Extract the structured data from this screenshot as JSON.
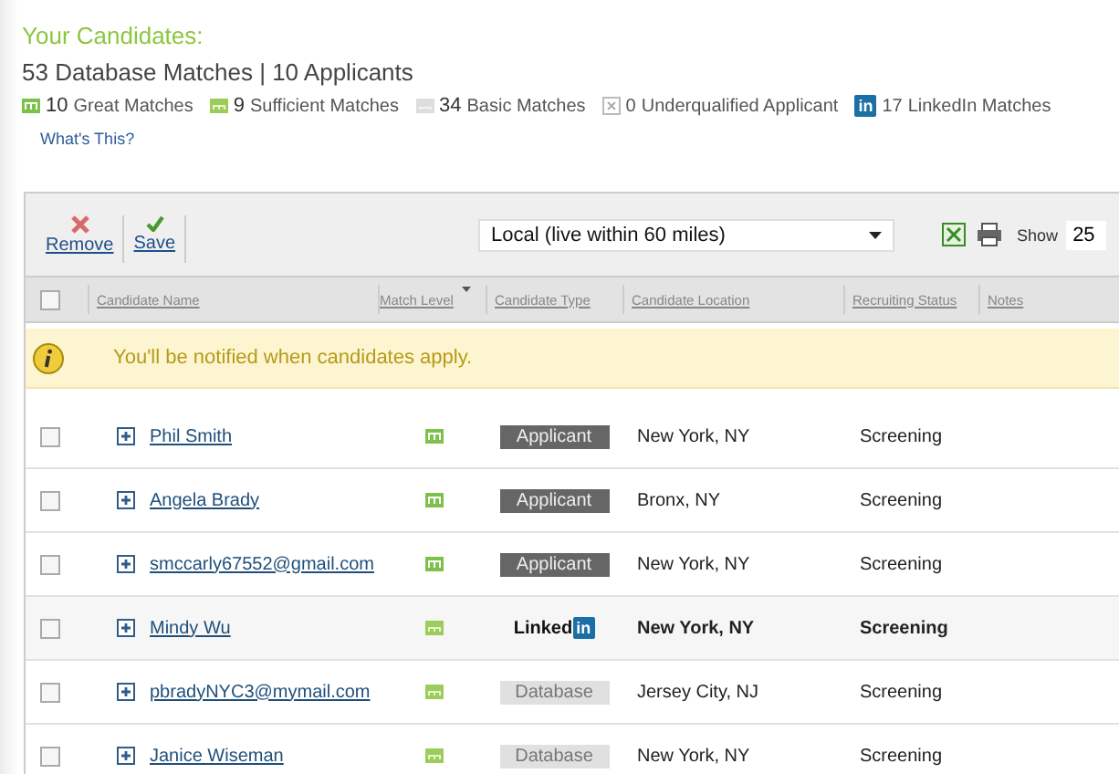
{
  "heading": "Your Candidates:",
  "subheading": "53 Database Matches | 10 Applicants",
  "summary": [
    {
      "kind": "great",
      "count": "10",
      "label": "Great Matches"
    },
    {
      "kind": "sufficient",
      "count": "9",
      "label": "Sufficient Matches"
    },
    {
      "kind": "basic",
      "count": "34",
      "label": "Basic Matches"
    },
    {
      "kind": "under",
      "count": "0",
      "label": "Underqualified Applicant"
    },
    {
      "kind": "linkedin",
      "count": "17",
      "label": "LinkedIn Matches",
      "icon_text": "in"
    }
  ],
  "whats_this": "What's This?",
  "toolbar": {
    "remove": "Remove",
    "save": "Save",
    "filter": "Local (live within 60 miles)",
    "show_label": "Show",
    "show_value": "25"
  },
  "select_all_checked": false,
  "columns": [
    {
      "label": "Candidate Name",
      "sorted": false
    },
    {
      "label": "Match Level",
      "sorted": true
    },
    {
      "label": "Candidate Type",
      "sorted": false
    },
    {
      "label": "Candidate Location",
      "sorted": false
    },
    {
      "label": "Recruiting Status",
      "sorted": false
    },
    {
      "label": "Notes",
      "sorted": false
    }
  ],
  "notice": "You'll be notified when candidates apply.",
  "rows": [
    {
      "checked": false,
      "name": "Phil Smith",
      "match": {
        "kind": "great"
      },
      "type": {
        "kind": "applicant",
        "text": "Applicant"
      },
      "location": "New York, NY",
      "status": "Screening",
      "selected": false
    },
    {
      "checked": false,
      "name": "Angela Brady",
      "match": {
        "kind": "great"
      },
      "type": {
        "kind": "applicant",
        "text": "Applicant"
      },
      "location": "Bronx, NY",
      "status": "Screening",
      "selected": false
    },
    {
      "checked": false,
      "name": "smccarly67552@gmail.com",
      "match": {
        "kind": "great"
      },
      "type": {
        "kind": "applicant",
        "text": "Applicant"
      },
      "location": "New York, NY",
      "status": "Screening",
      "selected": false
    },
    {
      "checked": false,
      "name": "Mindy Wu",
      "match": {
        "kind": "sufficient"
      },
      "type": {
        "kind": "linkedin",
        "text": "Linked",
        "badge": "in"
      },
      "location": "New York, NY",
      "status": "Screening",
      "selected": true
    },
    {
      "checked": false,
      "name": "pbradyNYC3@mymail.com",
      "match": {
        "kind": "sufficient"
      },
      "type": {
        "kind": "database",
        "text": "Database"
      },
      "location": "Jersey City, NJ",
      "status": "Screening",
      "selected": false
    },
    {
      "checked": false,
      "name": "Janice Wiseman",
      "match": {
        "kind": "sufficient"
      },
      "type": {
        "kind": "database",
        "text": "Database"
      },
      "location": "New York, NY",
      "status": "Screening",
      "selected": false
    }
  ]
}
